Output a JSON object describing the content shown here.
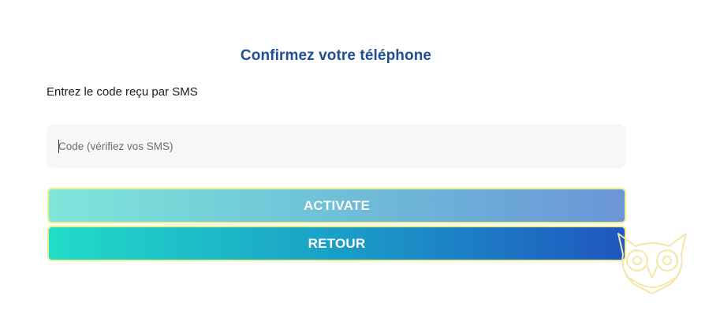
{
  "page": {
    "title": "Confirmez votre téléphone",
    "instruction": "Entrez le code reçu par SMS"
  },
  "code_input": {
    "value": "",
    "placeholder": "Code (vérifiez vos SMS)"
  },
  "buttons": {
    "activate_label": "ACTIVATE",
    "back_label": "RETOUR"
  },
  "colors": {
    "title": "#1f4f93",
    "field_background": "#f7f7f7",
    "button_border": "#e9f08c",
    "activate_gradient": [
      "#7fe6d9",
      "#6b95d8"
    ],
    "back_gradient": [
      "#22dcc8",
      "#1f56c0"
    ],
    "watermark": "#f3e6a8"
  },
  "icons": {
    "watermark": "owl-logo-icon"
  }
}
